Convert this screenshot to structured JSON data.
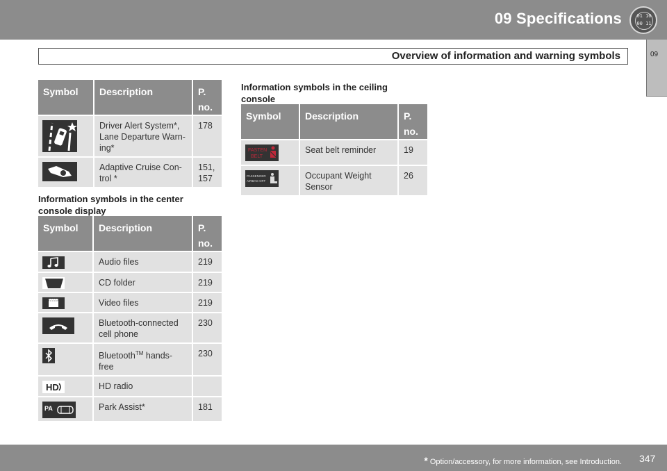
{
  "header": {
    "chapter_title": "09 Specifications",
    "section_title": "Overview of information and warning symbols",
    "side_tab": "09",
    "chapter_icon_text": "01 10 00 11"
  },
  "columns": {
    "symbol": "Symbol",
    "description": "Description",
    "page_no": "P. no."
  },
  "table_top": {
    "rows": [
      {
        "icon": "lane-departure-icon",
        "description": "Driver Alert System*, Lane Departure Warn-ing*",
        "page": "178"
      },
      {
        "icon": "adaptive-cruise-icon",
        "description": "Adaptive Cruise Con-trol *",
        "page": "151, 157"
      }
    ]
  },
  "center_console": {
    "heading": "Information symbols in the center console display",
    "rows": [
      {
        "icon": "music-note-icon",
        "description": "Audio files",
        "page": "219"
      },
      {
        "icon": "cd-folder-icon",
        "description": "CD folder",
        "page": "219"
      },
      {
        "icon": "clapperboard-icon",
        "description": "Video files",
        "page": "219"
      },
      {
        "icon": "phone-handset-icon",
        "description": "Bluetooth-connected cell phone",
        "page": "230"
      },
      {
        "icon": "bluetooth-icon",
        "description_pre": "Bluetooth",
        "description_sup": "TM",
        "description_post": " hands-free",
        "page": "230"
      },
      {
        "icon": "hd-radio-icon",
        "description": "HD radio",
        "page": ""
      },
      {
        "icon": "park-assist-icon",
        "description": "Park Assist*",
        "page": "181"
      }
    ]
  },
  "ceiling_console": {
    "heading": "Information symbols in the ceiling console",
    "rows": [
      {
        "icon": "fasten-belt-icon",
        "icon_text": "FASTEN BELT",
        "description": "Seat belt reminder",
        "page": "19"
      },
      {
        "icon": "passenger-airbag-off-icon",
        "icon_text": "PASSENGER AIRBAG OFF",
        "description": "Occupant Weight Sensor",
        "page": "26"
      }
    ]
  },
  "footer": {
    "note_star": "*",
    "note": " Option/accessory, for more information, see Introduction.",
    "page_number": "347"
  },
  "colors": {
    "bar_gray": "#8c8c8c",
    "cell_gray": "#e1e1e1",
    "icon_dark": "#333333",
    "belt_red": "#c0283a"
  }
}
